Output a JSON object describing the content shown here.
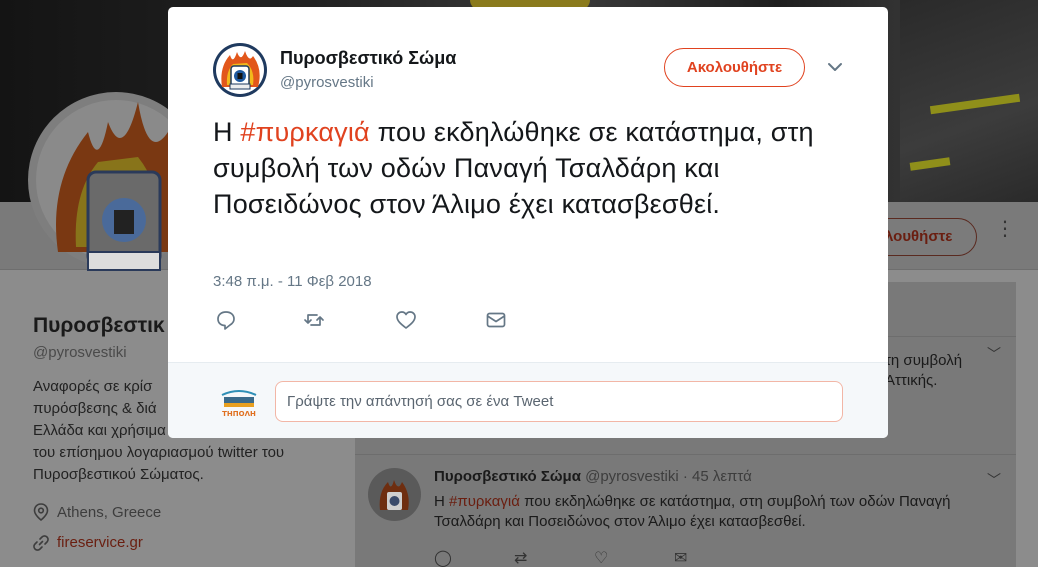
{
  "colors": {
    "accent": "#e0421f",
    "text_primary": "#14171a",
    "text_secondary": "#657786",
    "overlay": "#8c8c8c"
  },
  "background_profile": {
    "name": "Πυροσβεστικ",
    "handle": "@pyrosvestiki",
    "bio": "Αναφορές σε κρίσ πυρόσβεσης & διά Ελλάδα και χρήσιμα του επίσημου λογαριασμού twitter του Πυροσβεστικού Σώματος.",
    "bio_lines": [
      "Αναφορές σε κρίσ",
      "πυρόσβεσης & διά",
      "Ελλάδα και χρήσιμα",
      "του επίσημου λογαριασμού twitter του",
      "Πυροσβεστικού Σώματος."
    ],
    "location": "Athens, Greece",
    "link": "fireservice.gr",
    "follow_label": "λουθήστε",
    "location_icon": "map-pin-icon",
    "link_icon": "link-icon"
  },
  "timeline": {
    "item1_lines": [
      "τη συμβολή",
      "Αττικής."
    ],
    "item2": {
      "name": "Πυροσβεστικό Σώμα",
      "meta": "@pyrosvestiki · 45 λεπτά",
      "text_prefix": "Η ",
      "hashtag": "#πυρκαγιά",
      "text_rest": " που εκδηλώθηκε σε κατάστημα, στη συμβολή των οδών Παναγή Τσαλδάρη και Ποσειδώνος στον Άλιμο έχει κατασβεσθεί."
    }
  },
  "modal": {
    "author_name": "Πυροσβεστικό Σώμα",
    "author_handle": "@pyrosvestiki",
    "follow_label": "Ακολουθήστε",
    "text_prefix": "Η ",
    "hashtag": "#πυρκαγιά",
    "text_rest": " που εκδηλώθηκε σε κατάστημα, στη συμβολή των οδών Παναγή Τσαλδάρη και Ποσειδώνος στον Άλιμο έχει κατασβεσθεί.",
    "timestamp": "3:48 π.μ. - 11 Φεβ 2018",
    "actions": [
      "reply-icon",
      "retweet-icon",
      "like-icon",
      "message-icon"
    ],
    "reply_placeholder": "Γράψτε την απάντησή σας σε ένα Tweet",
    "reply_avatar_text": "ΤΗΠΟΛΗ"
  }
}
